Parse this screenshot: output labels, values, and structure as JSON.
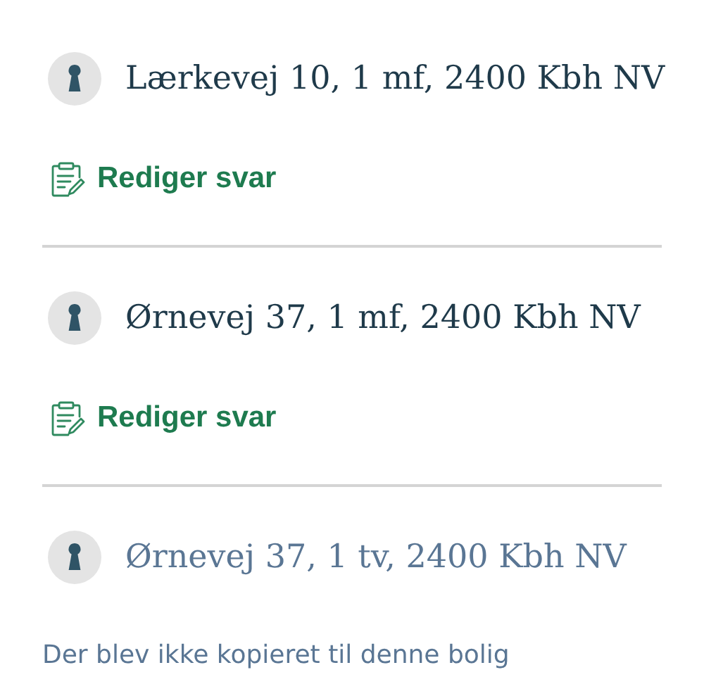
{
  "addresses": [
    {
      "address": "Lærkevej 10, 1 mf, 2400 Kbh NV",
      "kind": "copied",
      "action": "Rediger svar"
    },
    {
      "address": "Ørnevej 37, 1 mf, 2400 Kbh NV",
      "kind": "copied",
      "action": "Rediger svar"
    },
    {
      "address": "Ørnevej 37, 1 tv, 2400 Kbh NV",
      "kind": "not_copied",
      "message": "Der blev ikke kopieret til denne bolig"
    }
  ]
}
